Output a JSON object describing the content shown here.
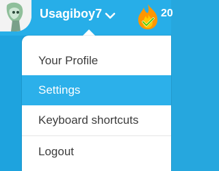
{
  "header": {
    "username": "Usagiboy7",
    "streak_count": "20"
  },
  "dropdown": {
    "items": [
      {
        "label": "Your Profile"
      },
      {
        "label": "Settings"
      },
      {
        "label": "Keyboard shortcuts"
      },
      {
        "label": "Logout"
      }
    ],
    "active_index": 1
  },
  "colors": {
    "accent_blue": "#2cb0ea",
    "header_blue": "#27aee8",
    "streak_orange": "#ff9600",
    "text_dark": "#3c3c3c"
  },
  "icons": {
    "avatar": "avatar-icon",
    "chevron": "chevron-down-icon",
    "streak": "streak-flame-icon"
  }
}
